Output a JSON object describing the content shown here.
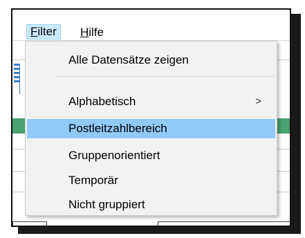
{
  "menubar": {
    "filter": {
      "label": "Filter",
      "mnemonic": "F",
      "rest": "ilter"
    },
    "help": {
      "label": "Hilfe",
      "mnemonic": "H",
      "rest": "ilfe"
    }
  },
  "filter_menu": {
    "items": [
      {
        "label": "Alle Datensätze zeigen",
        "submenu": false,
        "highlighted": false
      },
      {
        "label": "Alphabetisch",
        "submenu": true,
        "submenu_arrow": ">",
        "highlighted": false
      },
      {
        "label": "Postleitzahlbereich",
        "submenu": false,
        "highlighted": true
      },
      {
        "label": "Gruppenorientiert",
        "submenu": false,
        "highlighted": false
      },
      {
        "label": "Temporär",
        "submenu": false,
        "highlighted": false
      },
      {
        "label": "Nicht gruppiert",
        "submenu": false,
        "highlighted": false
      }
    ]
  },
  "colors": {
    "menu_background": "#f2f2f2",
    "highlight": "#91c9f7",
    "active_menu_top": "#cce8ff",
    "background_green_row": "#4aa171"
  }
}
